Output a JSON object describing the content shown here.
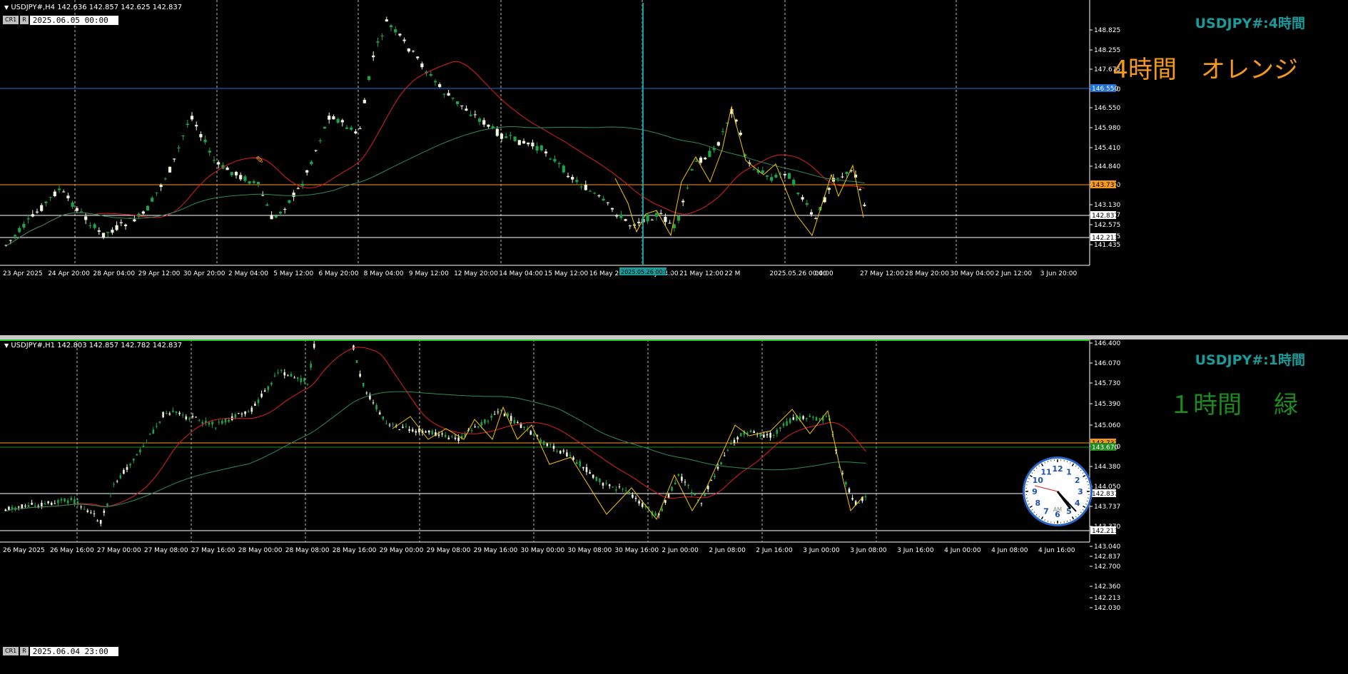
{
  "top": {
    "info": "USDJPY#,H4  142.636 142.857 142.625 142.837",
    "cr_tag": "CR1",
    "r_tag": "R",
    "date_value": "2025.06.05 00:00",
    "title": "USDJPY#:4時間",
    "label": "4時間　オレンジ",
    "label_color": "#f59a1a",
    "price_ticks": [
      "148.825",
      "148.255",
      "147.675",
      "147.120",
      "146.550",
      "145.980",
      "145.410",
      "144.840",
      "144.270",
      "143.737",
      "143.130",
      "142.837",
      "142.575",
      "142.213",
      "142.005",
      "141.435"
    ],
    "time_ticks": [
      "23 Apr 2025",
      "24 Apr 20:00",
      "28 Apr 04:00",
      "29 Apr 12:00",
      "30 Apr 20:00",
      "2 May 04:00",
      "5 May 12:00",
      "6 May 20:00",
      "8 May 04:00",
      "9 May 12:00",
      "12 May 20:00",
      "14 May 04:00",
      "15 May 12:00",
      "16 May 20:00",
      "20 May 04:00",
      "21 May 12:00",
      "22 M",
      "2025.05.26 00:00",
      "04:00",
      "27 May 12:00",
      "28 May 20:00",
      "30 May 04:00",
      "2 Jun 12:00",
      "3 Jun 20:00"
    ],
    "hlines": {
      "blue": "146.550",
      "orange": "143.737",
      "white": "142.213",
      "current": "142.837"
    }
  },
  "bottom": {
    "info": "USDJPY#,H1  142.803 142.857 142.782 142.837",
    "cr_tag": "CR1",
    "r_tag": "R",
    "date_value": "2025.06.04 23:00",
    "title": "USDJPY#:1時間",
    "label": "１時間　 緑",
    "label_color": "#1f8a1f",
    "price_ticks": [
      "146.400",
      "146.070",
      "145.730",
      "145.390",
      "145.060",
      "144.720",
      "144.380",
      "144.050",
      "143.737",
      "143.370",
      "143.040",
      "142.837",
      "142.700",
      "142.360",
      "142.213",
      "142.030"
    ],
    "time_ticks": [
      "26 May 2025",
      "26 May 16:00",
      "27 May 00:00",
      "27 May 08:00",
      "27 May 16:00",
      "28 May 00:00",
      "28 May 08:00",
      "28 May 16:00",
      "29 May 00:00",
      "29 May 08:00",
      "29 May 16:00",
      "30 May 00:00",
      "30 May 08:00",
      "30 May 16:00",
      "2 Jun 00:00",
      "2 Jun 08:00",
      "2 Jun 16:00",
      "3 Jun 00:00",
      "3 Jun 08:00",
      "3 Jun 16:00",
      "4 Jun 00:00",
      "4 Jun 08:00",
      "4 Jun 16:00"
    ],
    "hlines": {
      "orange": "143.737",
      "green": "143.670",
      "white": "142.213",
      "current": "142.837"
    },
    "clock_label": "AM",
    "clock_numbers": [
      "12",
      "1",
      "2",
      "3",
      "4",
      "5",
      "6",
      "7",
      "8",
      "9",
      "10",
      "11"
    ]
  }
}
